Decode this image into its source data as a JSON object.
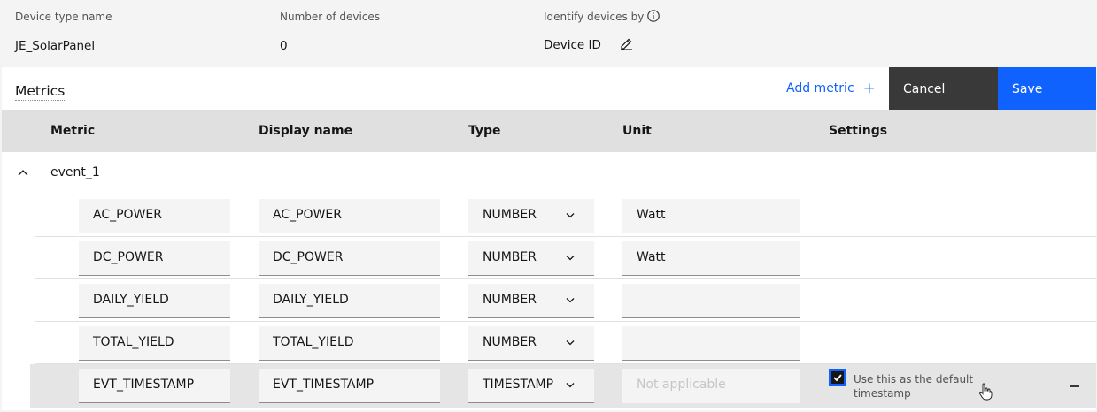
{
  "header": {
    "device_type_label": "Device type name",
    "device_type_value": "JE_SolarPanel",
    "num_devices_label": "Number of devices",
    "num_devices_value": "0",
    "identify_label": "Identify devices by",
    "identify_value": "Device ID"
  },
  "toolbar": {
    "title": "Metrics",
    "add_metric": "Add metric",
    "add_icon": "+",
    "cancel": "Cancel",
    "save": "Save"
  },
  "table": {
    "headers": [
      "Metric",
      "Display name",
      "Type",
      "Unit",
      "Settings"
    ],
    "group": "event_1",
    "rows": [
      {
        "metric": "AC_POWER",
        "display": "AC_POWER",
        "type": "NUMBER",
        "unit": "Watt"
      },
      {
        "metric": "DC_POWER",
        "display": "DC_POWER",
        "type": "NUMBER",
        "unit": "Watt"
      },
      {
        "metric": "DAILY_YIELD",
        "display": "DAILY_YIELD",
        "type": "NUMBER",
        "unit": ""
      },
      {
        "metric": "TOTAL_YIELD",
        "display": "TOTAL_YIELD",
        "type": "NUMBER",
        "unit": ""
      },
      {
        "metric": "EVT_TIMESTAMP",
        "display": "EVT_TIMESTAMP",
        "type": "TIMESTAMP",
        "unit_placeholder": "Not applicable",
        "setting_label": "Use this as the default timestamp",
        "setting_checked": true
      }
    ]
  },
  "colors": {
    "accent": "#0f62fe",
    "cancel_bg": "#393939",
    "header_bg": "#e0e0e0"
  },
  "icons": [
    "info-icon",
    "edit-icon",
    "plus-icon",
    "chevron-up-icon",
    "chevron-down-icon",
    "checkmark-icon",
    "subtract-icon"
  ]
}
